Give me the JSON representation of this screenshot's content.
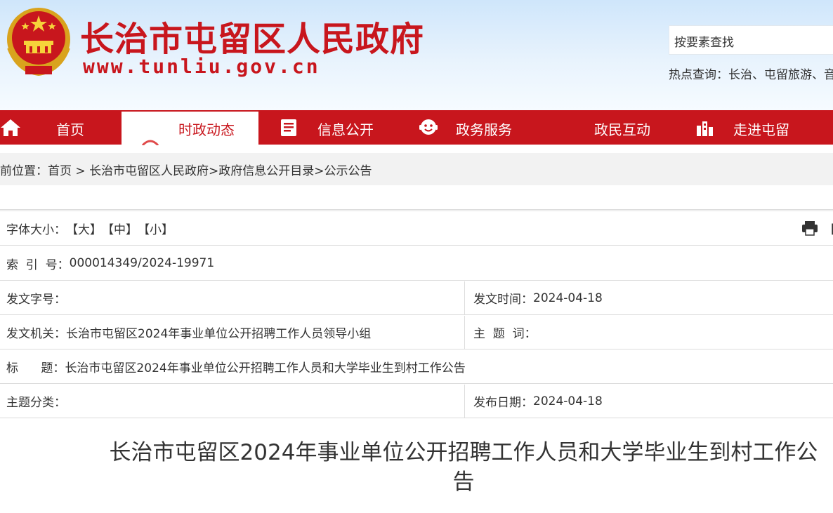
{
  "header": {
    "site_title": "长治市屯留区人民政府",
    "site_url": "www.tunliu.gov.cn",
    "search_placeholder": "按要素查找",
    "hotwords": "热点查询：长治、屯留旅游、⾳"
  },
  "nav": {
    "items": [
      {
        "label": "首页",
        "icon": "home-icon"
      },
      {
        "label": "时政动态",
        "icon": "news-icon",
        "active": true
      },
      {
        "label": "信息公开",
        "icon": "info-icon"
      },
      {
        "label": "政务服务",
        "icon": "service-icon"
      },
      {
        "label": "政民互动",
        "icon": "interaction-icon"
      },
      {
        "label": "走进屯留",
        "icon": "building-icon"
      }
    ]
  },
  "breadcrumb": {
    "prefix": "前位置：",
    "home": "首页",
    "sep": " > ",
    "path": "长治市屯留区人民政府>政府信息公开目录>公示公告"
  },
  "info": {
    "font_size_label": "字体大小：",
    "font_large": "【大】",
    "font_medium": "【中】",
    "font_small": "【小】",
    "print_bracket": "【",
    "index_label": "索  引  号：",
    "index_value": "000014349/2024-19971",
    "doc_no_label": "发文字号：",
    "doc_no_value": "",
    "doc_time_label": "发文时间：",
    "doc_time_value": "2024-04-18",
    "issuer_label": "发文机关：",
    "issuer_value": "长治市屯留区2024年事业单位公开招聘工作人员领导小组",
    "subject_label": "主  题  词：",
    "subject_value": "",
    "title_label": "标      题：",
    "title_value": "长治市屯留区2024年事业单位公开招聘工作人员和大学毕业生到村工作公告",
    "category_label": "主题分类：",
    "category_value": "",
    "publish_label": "发布日期：",
    "publish_value": "2024-04-18"
  },
  "article": {
    "title": "长治市屯留区2024年事业单位公开招聘工作人员和大学毕业生到村工作公告"
  },
  "colors": {
    "brand_red": "#c8161d",
    "header_blue": "#cfe6fb",
    "border": "#dcdcdc"
  }
}
